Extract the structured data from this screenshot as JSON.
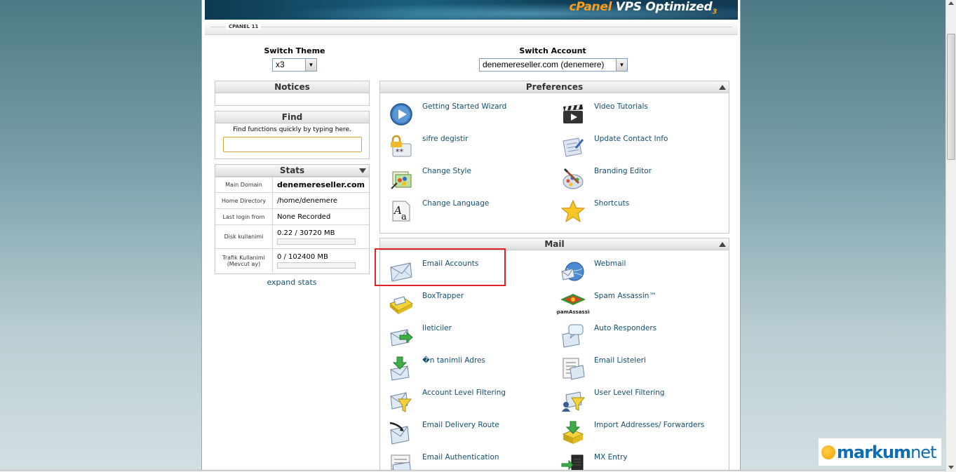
{
  "banner": {
    "brand_c": "cPanel",
    "brand_rest": "VPS Optimized",
    "brand_num": "3"
  },
  "tabbar": {
    "label": "CPANEL 11"
  },
  "switch_theme": {
    "title": "Switch Theme",
    "value": "x3"
  },
  "switch_account": {
    "title": "Switch Account",
    "value": "denemereseller.com (denemere)"
  },
  "notices": {
    "title": "Notices"
  },
  "find": {
    "title": "Find",
    "hint": "Find functions quickly by typing here.",
    "value": ""
  },
  "stats": {
    "title": "Stats",
    "rows": [
      {
        "key": "Main Domain",
        "value": "denemereseller.com"
      },
      {
        "key": "Home Directory",
        "value": "/home/denemere"
      },
      {
        "key": "Last login from",
        "value": "None Recorded"
      },
      {
        "key": "Disk kullanimi",
        "value": "0.22 / 30720 MB",
        "fill": 0
      },
      {
        "key": "Trafik Kullanimi (Mevcut ay)",
        "value": "0 / 102400 MB",
        "fill": 0
      }
    ],
    "expand": "expand stats"
  },
  "preferences": {
    "title": "Preferences",
    "items": [
      {
        "label": "Getting Started Wizard",
        "icon": "play-icon"
      },
      {
        "label": "Video Tutorials",
        "icon": "film-clapper-icon"
      },
      {
        "label": "sifre degistir",
        "icon": "lock-password-icon"
      },
      {
        "label": "Update Contact Info",
        "icon": "contact-card-icon"
      },
      {
        "label": "Change Style",
        "icon": "style-palette-icon"
      },
      {
        "label": "Branding Editor",
        "icon": "brush-palette-icon"
      },
      {
        "label": "Change Language",
        "icon": "language-icon"
      },
      {
        "label": "Shortcuts",
        "icon": "star-icon"
      }
    ]
  },
  "mail": {
    "title": "Mail",
    "items": [
      {
        "label": "Email Accounts",
        "icon": "envelope-icon"
      },
      {
        "label": "Webmail",
        "icon": "webmail-globe-icon"
      },
      {
        "label": "BoxTrapper",
        "icon": "boxtrapper-icon"
      },
      {
        "label": "Spam Assassin™",
        "icon": "spam-assassin-icon",
        "icon_text": "SpamAssassin"
      },
      {
        "label": "Ileticiler",
        "icon": "forwarder-icon"
      },
      {
        "label": "Auto Responders",
        "icon": "autoresponder-icon"
      },
      {
        "label": "�n tanimli Adres",
        "icon": "default-address-icon"
      },
      {
        "label": "Email Listeleri",
        "icon": "mailing-list-icon"
      },
      {
        "label": "Account Level Filtering",
        "icon": "account-filter-icon"
      },
      {
        "label": "User Level Filtering",
        "icon": "user-filter-icon"
      },
      {
        "label": "Email Delivery Route",
        "icon": "delivery-route-icon"
      },
      {
        "label": "Import Addresses/ Forwarders",
        "icon": "import-icon"
      },
      {
        "label": "Email Authentication",
        "icon": "authentication-icon"
      },
      {
        "label": "MX Entry",
        "icon": "mx-entry-icon"
      }
    ]
  },
  "watermark": {
    "part1": "markum",
    "part2": "net"
  }
}
